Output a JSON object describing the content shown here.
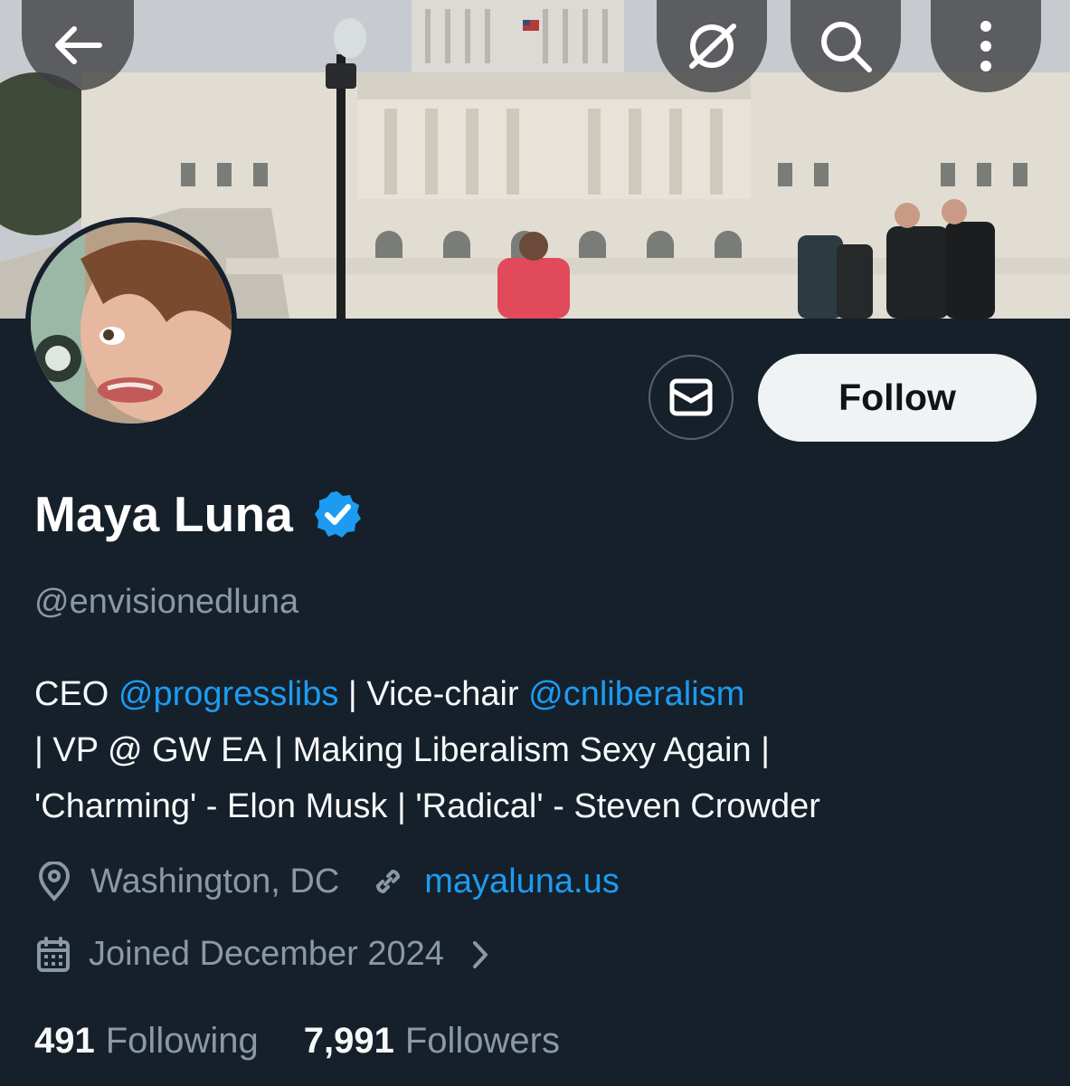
{
  "header": {
    "back_icon": "arrow-left-icon",
    "grok_icon": "grok-icon",
    "search_icon": "search-icon",
    "more_icon": "more-vertical-icon"
  },
  "profile": {
    "name": "Maya Luna",
    "verified": true,
    "handle": "@envisionedluna",
    "follow_label": "Follow",
    "message_icon": "mail-icon"
  },
  "bio": {
    "lines": [
      [
        {
          "text": "CEO ",
          "link": false
        },
        {
          "text": "@progresslibs",
          "link": true
        },
        {
          "text": " | Vice-chair ",
          "link": false
        },
        {
          "text": "@cnliberalism",
          "link": true
        }
      ],
      [
        {
          "text": "| VP @ GW EA |  Making Liberalism Sexy Again |",
          "link": false
        }
      ],
      [
        {
          "text": "'Charming' - Elon Musk | 'Radical' - Steven Crowder",
          "link": false
        }
      ]
    ]
  },
  "meta": {
    "location": "Washington, DC",
    "website": "mayaluna.us",
    "joined": "Joined December 2024"
  },
  "stats": {
    "following_count": "491",
    "following_label": "Following",
    "followers_count": "7,991",
    "followers_label": "Followers"
  },
  "colors": {
    "background": "#15202b",
    "accent": "#1d9bf0",
    "secondary_text": "#8b98a5"
  }
}
